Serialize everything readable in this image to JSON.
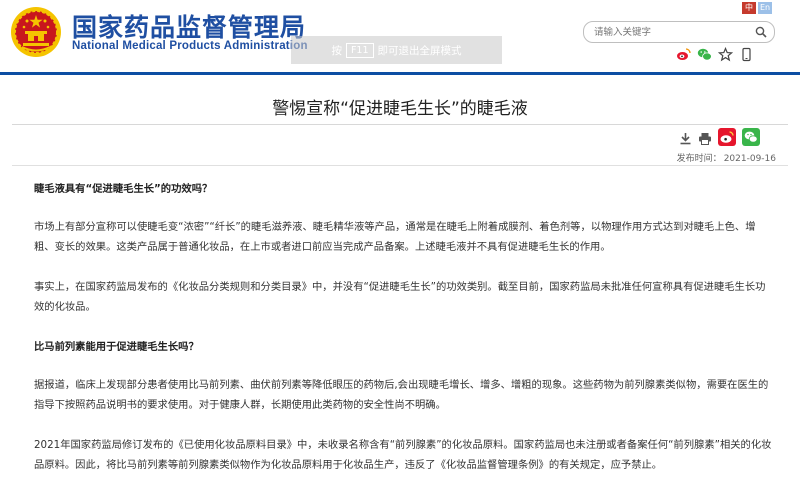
{
  "header": {
    "site_name": "国家药品监督管理局",
    "site_name_en": "National Medical Products Administration",
    "lang": {
      "zh": "中",
      "en": "En"
    },
    "search_placeholder": "请输入关键字",
    "fullscreen_hint": {
      "prefix": "按",
      "key": "F11",
      "suffix": "即可退出全屏模式"
    },
    "social_icons": [
      "weibo-icon",
      "wechat-icon",
      "star-icon",
      "mobile-icon"
    ]
  },
  "article": {
    "title": "警惕宣称“促进睫毛生长”的睫毛液",
    "tools": [
      "download-icon",
      "print-icon",
      "share-weibo-icon",
      "share-wechat-icon"
    ],
    "pub_date_label": "发布时间：",
    "pub_date": "2021-09-16",
    "paragraphs": [
      {
        "type": "heading",
        "text": "睫毛液具有“促进睫毛生长”的功效吗？"
      },
      {
        "type": "body",
        "text": "市场上有部分宣称可以使睫毛变“浓密”“纤长”的睫毛滋养液、睫毛精华液等产品，通常是在睫毛上附着成膜剂、着色剂等，以物理作用方式达到对睫毛上色、增粗、变长的效果。这类产品属于普通化妆品，在上市或者进口前应当完成产品备案。上述睫毛液并不具有促进睫毛生长的作用。"
      },
      {
        "type": "body",
        "text": "事实上，在国家药监局发布的《化妆品分类规则和分类目录》中，并没有“促进睫毛生长”的功效类别。截至目前，国家药监局未批准任何宣称具有促进睫毛生长功效的化妆品。"
      },
      {
        "type": "heading",
        "text": "比马前列素能用于促进睫毛生长吗？"
      },
      {
        "type": "body",
        "text": "据报道，临床上发现部分患者使用比马前列素、曲伏前列素等降低眼压的药物后,会出现睫毛增长、增多、增粗的现象。这些药物为前列腺素类似物，需要在医生的指导下按照药品说明书的要求使用。对于健康人群，长期使用此类药物的安全性尚不明确。"
      },
      {
        "type": "body",
        "text": "2021年国家药监局修订发布的《已使用化妆品原料目录》中，未收录名称含有“前列腺素”的化妆品原料。国家药监局也未注册或者备案任何“前列腺素”相关的化妆品原料。因此，将比马前列素等前列腺素类似物作为化妆品原料用于化妆品生产，违反了《化妆品监督管理条例》的有关规定，应予禁止。"
      }
    ]
  },
  "colors": {
    "brand_blue": "#1f4fa2",
    "rule_blue": "#0c4ea3",
    "emblem_red": "#c8161d",
    "emblem_gold": "#f5c400"
  }
}
